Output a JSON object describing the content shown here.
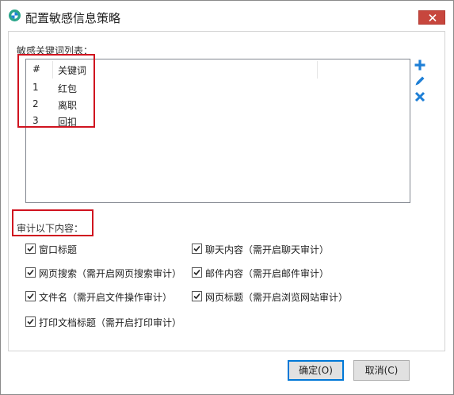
{
  "window": {
    "title": "配置敏感信息策略"
  },
  "keywords": {
    "label": "敏感关键词列表：",
    "columns": [
      "#",
      "关键词"
    ],
    "rows": [
      {
        "index": "1",
        "keyword": "红包"
      },
      {
        "index": "2",
        "keyword": "离职"
      },
      {
        "index": "3",
        "keyword": "回扣"
      }
    ],
    "tools": [
      "add-icon",
      "edit-icon",
      "delete-icon"
    ]
  },
  "audit": {
    "label": "审计以下内容：",
    "items": {
      "window_title": {
        "label": "窗口标题",
        "checked": true
      },
      "chat_content": {
        "label": "聊天内容（需开启聊天审计）",
        "checked": true
      },
      "web_search": {
        "label": "网页搜索（需开启网页搜索审计）",
        "checked": true
      },
      "mail_content": {
        "label": "邮件内容（需开启邮件审计）",
        "checked": true
      },
      "file_name": {
        "label": "文件名（需开启文件操作审计）",
        "checked": true
      },
      "web_title": {
        "label": "网页标题（需开启浏览网站审计）",
        "checked": true
      },
      "print_title": {
        "label": "打印文档标题（需开启打印审计）",
        "checked": true
      }
    }
  },
  "buttons": {
    "ok": "确定(O)",
    "cancel": "取消(C)"
  },
  "colors": {
    "accent": "#1e7fd6",
    "highlight": "#d0131f",
    "close": "#c7463d"
  }
}
